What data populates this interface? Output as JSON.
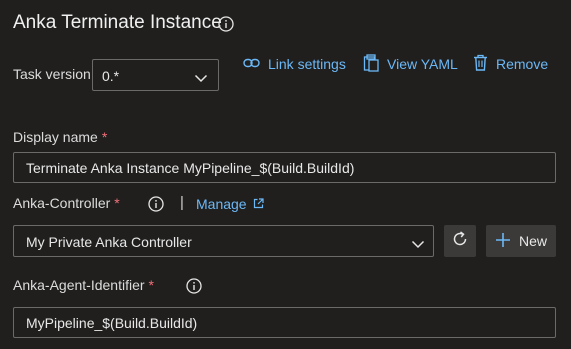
{
  "header": {
    "title": "Anka Terminate Instance",
    "info_icon": "info-icon"
  },
  "task_version": {
    "label": "Task version",
    "value": "0.*",
    "icon": "chevron-down-icon"
  },
  "actions": {
    "link_settings": {
      "label": "Link settings",
      "icon": "link-icon"
    },
    "view_yaml": {
      "label": "View YAML",
      "icon": "clipboard-icon"
    },
    "remove": {
      "label": "Remove",
      "icon": "trash-icon"
    }
  },
  "display_name": {
    "label": "Display name",
    "required_mark": "*",
    "value": "Terminate Anka Instance MyPipeline_$(Build.BuildId)"
  },
  "anka_controller": {
    "label": "Anka-Controller",
    "required_mark": "*",
    "separator": "|",
    "manage_label": "Manage",
    "manage_icon": "external-link-icon",
    "value": "My Private Anka Controller",
    "refresh_icon": "refresh-icon",
    "new_label": "New",
    "new_icon": "plus-icon"
  },
  "anka_agent_identifier": {
    "label": "Anka-Agent-Identifier",
    "required_mark": "*",
    "value": "MyPipeline_$(Build.BuildId)"
  },
  "colors": {
    "background": "#201f1e",
    "link": "#6cb8f6",
    "required": "#f1707b",
    "button": "#3b3a39",
    "border": "#6b6a69"
  }
}
